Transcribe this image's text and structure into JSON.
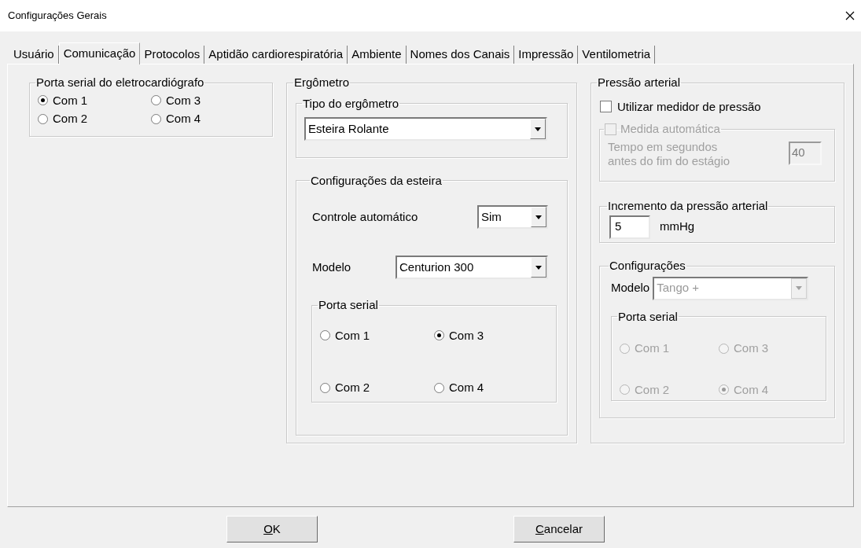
{
  "window": {
    "title": "Configurações Gerais"
  },
  "tabs": [
    {
      "label": "Usuário",
      "selected": false
    },
    {
      "label": "Comunicação",
      "selected": true
    },
    {
      "label": "Protocolos",
      "selected": false
    },
    {
      "label": "Aptidão cardiorespiratória",
      "selected": false
    },
    {
      "label": "Ambiente",
      "selected": false
    },
    {
      "label": "Nomes dos Canais",
      "selected": false
    },
    {
      "label": "Impressão",
      "selected": false
    },
    {
      "label": "Ventilometria",
      "selected": false
    }
  ],
  "ecg_serial_port": {
    "title": "Porta serial do eletrocardiógrafo",
    "options": [
      {
        "label": "Com 1",
        "selected": true
      },
      {
        "label": "Com 3",
        "selected": false
      },
      {
        "label": "Com 2",
        "selected": false
      },
      {
        "label": "Com 4",
        "selected": false
      }
    ]
  },
  "ergometer": {
    "title": "Ergômetro",
    "type_group": {
      "title": "Tipo do ergômetro",
      "value": "Esteira Rolante"
    },
    "treadmill": {
      "title": "Configurações da esteira",
      "auto_control": {
        "label": "Controle automático",
        "value": "Sim"
      },
      "model": {
        "label": "Modelo",
        "value": "Centurion 300"
      },
      "serial_port": {
        "title": "Porta serial",
        "options": [
          {
            "label": "Com 1",
            "selected": false
          },
          {
            "label": "Com 3",
            "selected": true
          },
          {
            "label": "Com 2",
            "selected": false
          },
          {
            "label": "Com 4",
            "selected": false
          }
        ]
      }
    }
  },
  "blood_pressure": {
    "title": "Pressão arterial",
    "use_meter": {
      "label": "Utilizar medidor de pressão",
      "checked": false
    },
    "automatic": {
      "label": "Medida automática",
      "checked": false,
      "disabled": true,
      "time_label": "Tempo em segundos antes do fim do estágio",
      "time_value": "40"
    },
    "increment": {
      "title": "Incremento da pressão arterial",
      "value": "5",
      "unit": "mmHg"
    },
    "config": {
      "title": "Configurações",
      "model_label": "Modelo",
      "model_value": "Tango +",
      "disabled": true,
      "serial_port": {
        "title": "Porta serial",
        "options": [
          {
            "label": "Com 1",
            "selected": false
          },
          {
            "label": "Com 3",
            "selected": false
          },
          {
            "label": "Com 2",
            "selected": false
          },
          {
            "label": "Com 4",
            "selected": true
          }
        ]
      }
    }
  },
  "buttons": [
    {
      "label": "OK",
      "mnemonic": true
    },
    {
      "label": "Cancelar",
      "mnemonic": true
    }
  ]
}
